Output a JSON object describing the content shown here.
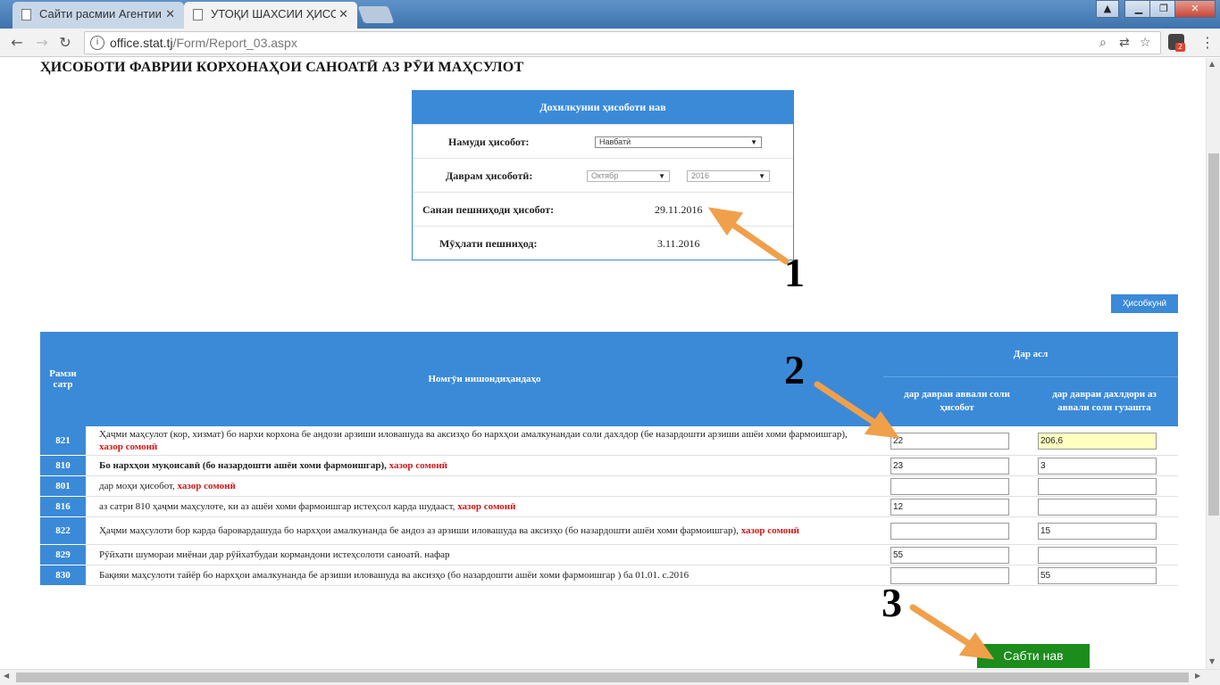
{
  "browser": {
    "tabs": [
      {
        "label": "Сайти расмии Агентии",
        "active": false
      },
      {
        "label": "УТОҚИ ШАХСИИ ҲИСО",
        "active": true
      }
    ],
    "url_host": "office.stat.tj",
    "url_path": "/Form/Report_03.aspx",
    "extension_badge": "2"
  },
  "page": {
    "title": "ҲИСОБОТИ ФАВРИИ КОРХОНАҲОИ САНОАТӢ АЗ РӮИ МАҲСУЛОТ"
  },
  "report_info": {
    "header": "Дохилкунии ҳисоботи нав",
    "type_label": "Намуди ҳисобот:",
    "type_value": "Навбатӣ",
    "period_label": "Даврам ҳисоботӣ:",
    "period_month": "Октябр",
    "period_year": "2016",
    "submit_date_label": "Санаи пешниҳоди ҳисобот:",
    "submit_date_value": "29.11.2016",
    "deadline_label": "Мӯҳлати пешниҳод:",
    "deadline_value": "3.11.2016"
  },
  "calc_button": "Ҳисобкунӣ",
  "table": {
    "col_code": "Рамзи сатр",
    "col_name": "Номгӯи нишондиҳандаҳо",
    "col_group": "Дар асл",
    "col_current": "дар давраи аввали соли ҳисобот",
    "col_previous": "дар давраи дахлдори аз аввали соли гузашта",
    "rows": [
      {
        "code": "821",
        "name": "Ҳаҷми маҳсулот (кор, хизмат) бо нархи корхона бе андози арзиши иловашуда ва аксизҳо бо нархҳои амалкунандаи соли дахлдор (бе назардошти арзиши ашёи хоми фармоишгар),",
        "unit": "хазор сомонӣ",
        "bold": false,
        "current": "22",
        "previous": "206,6"
      },
      {
        "code": "810",
        "name": "Бо нархҳои муқоисавӣ (бо назардошти ашёи хоми фармоишгар),",
        "unit": "хазор сомонӣ",
        "bold": true,
        "current": "23",
        "previous": "3"
      },
      {
        "code": "801",
        "name": "дар моҳи ҳисобот,",
        "unit": "хазор сомонӣ",
        "bold": false,
        "current": "",
        "previous": ""
      },
      {
        "code": "816",
        "name": "аз сатри 810 ҳаҷми маҳсулоте, ки аз ашёи хоми фармоишгар истеҳсол карда шудааст,",
        "unit": "хазор сомонӣ",
        "bold": false,
        "current": "12",
        "previous": ""
      },
      {
        "code": "822",
        "name": "Ҳаҷми маҳсулоти бор карда баровардашуда бо нархҳои амалкунанда бе андоз аз арзиши иловашуда ва аксизҳо (бо назардошти ашёи хоми фармоишгар),",
        "unit": "хазор сомонӣ",
        "bold": false,
        "current": "",
        "previous": "15"
      },
      {
        "code": "829",
        "name": "Рӯйхати шумораи миёнаи дар рӯйхатбудаи кормандони истеҳсолоти саноатӣ. нафар",
        "unit": "",
        "bold": false,
        "current": "55",
        "previous": ""
      },
      {
        "code": "830",
        "name": "Бақияи маҳсулоти тайёр бо нархҳои амалкунанда бе арзиши иловашуда ва аксизҳо (бо назардошти ашёи хоми фармоишгар ) ба 01.01. с.2016",
        "unit": "",
        "bold": false,
        "current": "",
        "previous": "55"
      }
    ]
  },
  "save_button": "Сабти нав",
  "annotations": [
    "1",
    "2",
    "3"
  ],
  "colors": {
    "accent": "#3b8ad8",
    "save": "#1c8c1c",
    "unit_text": "#d01818",
    "arrow": "#f0a04b"
  }
}
